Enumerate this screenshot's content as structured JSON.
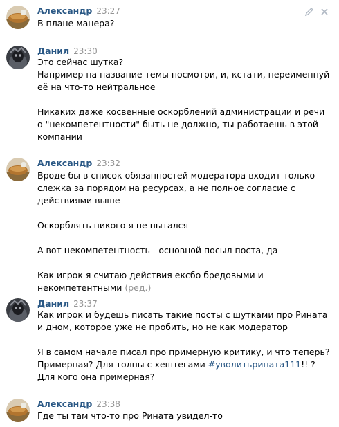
{
  "messages": [
    {
      "author": "Александр",
      "time": "23:27",
      "avatar": "avatar-alexander",
      "lines": [
        "В плане манера?"
      ]
    },
    {
      "author": "Данил",
      "time": "23:30",
      "avatar": "avatar-danil",
      "lines": [
        "Это сейчас шутка?",
        "Например на название темы посмотри, и, кстати, переименнуй",
        "её на что-то нейтральное",
        "",
        "Никаких даже косвенные оскорблений администрации и речи",
        "о \"некомпетентности\" быть не должно, ты работаешь в этой",
        "компании"
      ]
    },
    {
      "author": "Александр",
      "time": "23:32",
      "avatar": "avatar-alexander",
      "lines": [
        "Вроде бы в список обязанностей модератора входит только",
        "слежка за порядом на ресурсах, а не полное согласие с",
        "действиями выше",
        "",
        "Оскорблять никого я не пытался",
        "",
        "А вот некомпетентность - основной посыл поста, да",
        "",
        "Как игрок я считаю действия ексбо бредовыми и",
        "некомпетентными"
      ],
      "edited_label": "(ред.)"
    },
    {
      "author": "Данил",
      "time": "23:37",
      "avatar": "avatar-danil",
      "lines": [
        "Как игрок и будешь писать такие посты с шутками про Рината",
        "и дном, которое уже не пробить, но не как модератор",
        "",
        "Я в самом начале писал про примерную критику, и что теперь?",
        "Примерная? Для толпы с хештегами",
        "Для кого она примерная?"
      ],
      "hashtag": "#уволитьрината111",
      "hashtag_suffix": "!! ?"
    },
    {
      "author": "Александр",
      "time": "23:38",
      "avatar": "avatar-alexander",
      "lines": [
        "Где ты там что-то про Рината увидел-то"
      ]
    }
  ],
  "actions": {
    "edit_icon": "pencil-icon",
    "delete_icon": "close-icon"
  },
  "colors": {
    "author": "#2a5885",
    "time": "#939393",
    "text": "#000000",
    "link": "#2a5885"
  }
}
